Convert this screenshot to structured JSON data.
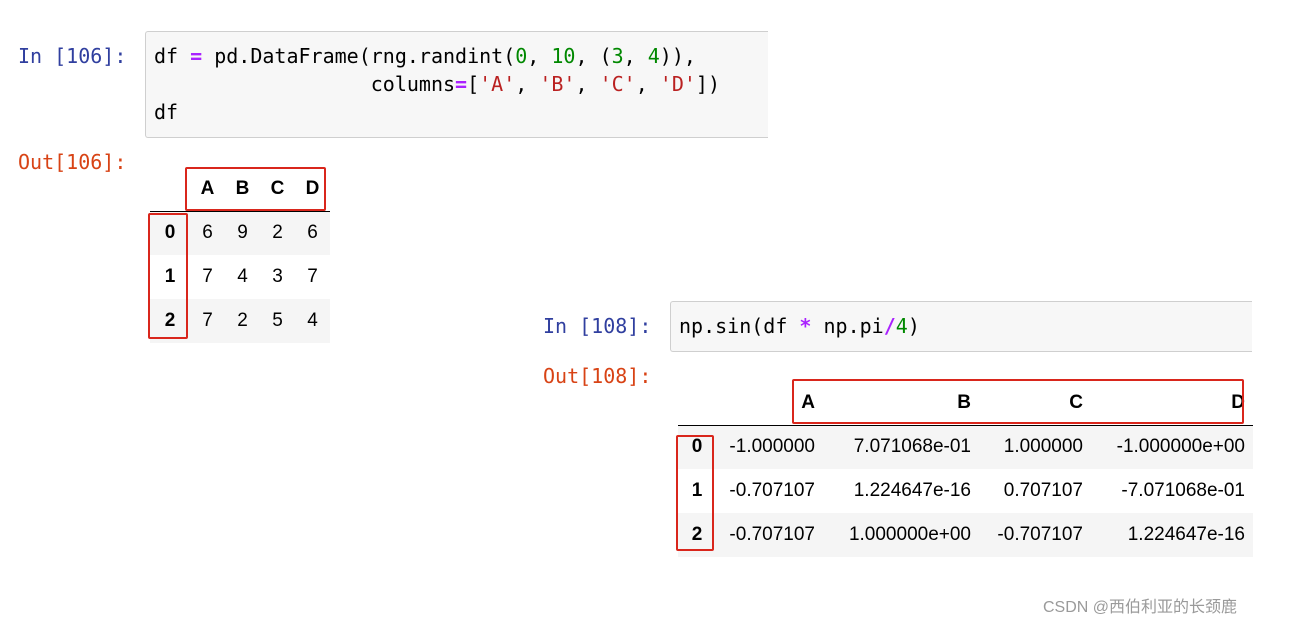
{
  "cell1": {
    "in_prompt": "In [106]:",
    "out_prompt": "Out[106]:",
    "code": {
      "line1": {
        "a": "df ",
        "eq": "=",
        "b": " pd.DataFrame(rng.randint(",
        "n0": "0",
        "c": ", ",
        "n10": "10",
        "d": ", (",
        "n3": "3",
        "e": ", ",
        "n4": "4",
        "f": ")),"
      },
      "line2": {
        "pad": "                  columns",
        "eq": "=",
        "a": "[",
        "sA": "'A'",
        "c1": ", ",
        "sB": "'B'",
        "c2": ", ",
        "sC": "'C'",
        "c3": ", ",
        "sD": "'D'",
        "end": "])"
      },
      "line3": "df"
    },
    "table": {
      "columns": [
        "A",
        "B",
        "C",
        "D"
      ],
      "index": [
        "0",
        "1",
        "2"
      ],
      "rows": [
        [
          "6",
          "9",
          "2",
          "6"
        ],
        [
          "7",
          "4",
          "3",
          "7"
        ],
        [
          "7",
          "2",
          "5",
          "4"
        ]
      ]
    }
  },
  "cell2": {
    "in_prompt": "In [108]:",
    "out_prompt": "Out[108]:",
    "code": {
      "a": "np.sin(df ",
      "op": "*",
      "b": " np.pi",
      "slash": "/",
      "n4": "4",
      "end": ")"
    },
    "table": {
      "columns": [
        "A",
        "B",
        "C",
        "D"
      ],
      "index": [
        "0",
        "1",
        "2"
      ],
      "rows": [
        [
          "-1.000000",
          "7.071068e-01",
          "1.000000",
          "-1.000000e+00"
        ],
        [
          "-0.707107",
          "1.224647e-16",
          "0.707107",
          "-7.071068e-01"
        ],
        [
          "-0.707107",
          "1.000000e+00",
          "-0.707107",
          "1.224647e-16"
        ]
      ]
    }
  },
  "watermark": "CSDN @西伯利亚的长颈鹿",
  "colors": {
    "in_prompt": "#303F9F",
    "out_prompt": "#D84315",
    "highlight_box": "#d9261c",
    "keyword_operator": "#AA22FF",
    "number": "#008800",
    "string": "#BA2121"
  }
}
